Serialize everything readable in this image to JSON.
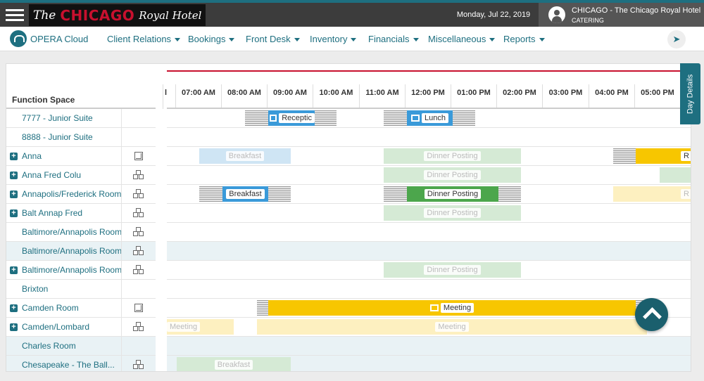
{
  "topbar": {
    "logo_the": "The",
    "logo_chicago": "CHICAGO",
    "logo_royal": "Royal Hotel",
    "date": "Monday, Jul 22, 2019",
    "property": "CHICAGO - The Chicago Royal Hotel",
    "role": "CATERING"
  },
  "nav": {
    "brand": "OPERA Cloud",
    "menus": [
      "Client Relations",
      "Bookings",
      "Front Desk",
      "Inventory",
      "Financials",
      "Miscellaneous",
      "Reports"
    ]
  },
  "grid": {
    "column_title": "Function Space",
    "times": [
      "07:00 AM",
      "08:00 AM",
      "09:00 AM",
      "10:00 AM",
      "11:00 AM",
      "12:00 PM",
      "01:00 PM",
      "02:00 PM",
      "03:00 PM",
      "04:00 PM",
      "05:00 PM"
    ],
    "partial_time": "l",
    "rows": [
      {
        "name": "7777 - Junior Suite",
        "expand": false,
        "icon": "none"
      },
      {
        "name": "8888 - Junior Suite",
        "expand": false,
        "icon": "none"
      },
      {
        "name": "Anna",
        "expand": true,
        "icon": "cube-icon"
      },
      {
        "name": "Anna Fred Colu",
        "expand": true,
        "icon": "cubes-icon"
      },
      {
        "name": "Annapolis/Frederick Room",
        "expand": true,
        "icon": "cubes-icon"
      },
      {
        "name": "Balt Annap Fred",
        "expand": true,
        "icon": "cubes-icon"
      },
      {
        "name": "Baltimore/Annapolis Room",
        "expand": false,
        "icon": "cubes-icon"
      },
      {
        "name": "Baltimore/Annapolis Room",
        "expand": false,
        "icon": "cubes-icon"
      },
      {
        "name": "Baltimore/Annapolis Room",
        "expand": true,
        "icon": "cubes-icon"
      },
      {
        "name": "Brixton",
        "expand": false,
        "icon": "none"
      },
      {
        "name": "Camden Room",
        "expand": true,
        "icon": "cube-icon"
      },
      {
        "name": "Camden/Lombard",
        "expand": true,
        "icon": "cubes-icon"
      },
      {
        "name": "Charles Room",
        "expand": false,
        "icon": "none"
      },
      {
        "name": "Chesapeake - The Ball...",
        "expand": false,
        "icon": "cubes-icon"
      }
    ]
  },
  "events": {
    "reception": "Receptic",
    "lunch": "Lunch",
    "breakfast": "Breakfast",
    "dinner_posting": "Dinner Posting",
    "meeting": "Meeting",
    "meeting_partial": "Meeting",
    "r_partial": "R"
  },
  "sidebar_tab": "Day Details",
  "colors": {
    "teal": "#1e6f80",
    "blue_event": "#3a9ad9",
    "green_event": "#4ca64c",
    "yellow_event": "#f7c600",
    "red_line": "#c8102e"
  }
}
